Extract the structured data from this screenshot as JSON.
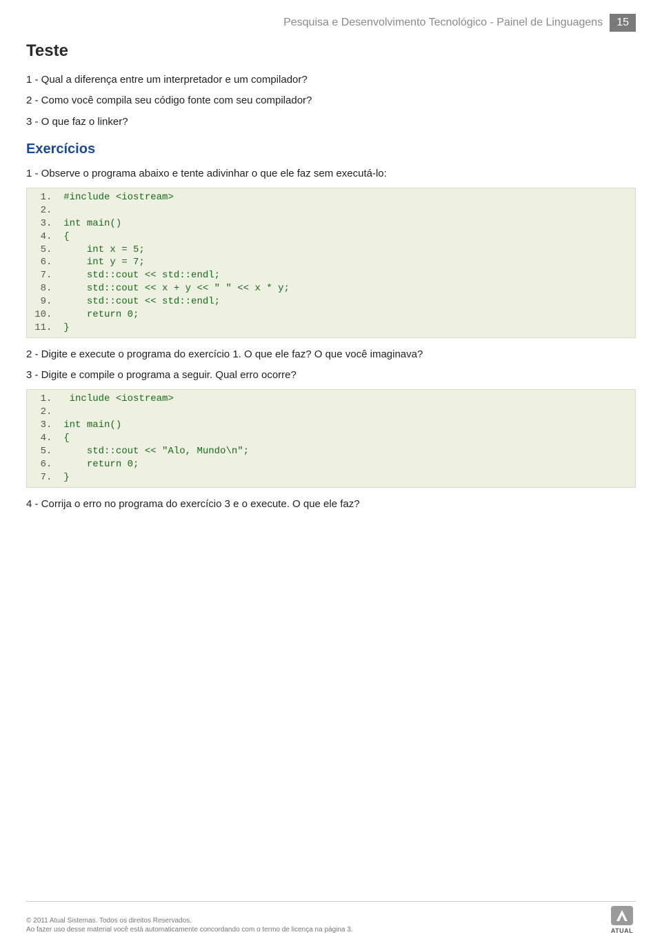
{
  "header": {
    "title": "Pesquisa e Desenvolvimento Tecnológico - Painel de Linguagens",
    "page_number": "15"
  },
  "section_test": {
    "heading": "Teste",
    "items": [
      "1 - Qual a diferença entre um interpretador e um compilador?",
      "2 - Como você compila seu código fonte com seu compilador?",
      "3 - O que faz o linker?"
    ]
  },
  "section_exercises": {
    "heading": "Exercícios",
    "intro1": "1 - Observe o programa abaixo e tente adivinhar o que ele faz sem executá-lo:",
    "code1": [
      {
        "n": "1",
        "text": "#include <iostream>",
        "cls": "kw"
      },
      {
        "n": "2",
        "text": "",
        "cls": ""
      },
      {
        "n": "3",
        "text": "int main()",
        "cls": "kw"
      },
      {
        "n": "4",
        "text": "{",
        "cls": "kw"
      },
      {
        "n": "5",
        "text": "    int x = 5;",
        "cls": "kw"
      },
      {
        "n": "6",
        "text": "    int y = 7;",
        "cls": "kw"
      },
      {
        "n": "7",
        "text": "    std::cout << std::endl;",
        "cls": "kw"
      },
      {
        "n": "8",
        "text": "    std::cout << x + y << \" \" << x * y;",
        "cls": "kw"
      },
      {
        "n": "9",
        "text": "    std::cout << std::endl;",
        "cls": "kw"
      },
      {
        "n": "10",
        "text": "    return 0;",
        "cls": "kw"
      },
      {
        "n": "11",
        "text": "}",
        "cls": "kw"
      }
    ],
    "intro2": "2 - Digite e execute o programa do exercício 1. O que ele faz? O que você imaginava?",
    "intro3": "3 - Digite e compile o programa a seguir. Qual erro ocorre?",
    "code2": [
      {
        "n": "1",
        "text": " include <iostream>",
        "cls": "kw"
      },
      {
        "n": "2",
        "text": "",
        "cls": ""
      },
      {
        "n": "3",
        "text": "int main()",
        "cls": "kw"
      },
      {
        "n": "4",
        "text": "{",
        "cls": "kw"
      },
      {
        "n": "5",
        "text": "    std::cout << \"Alo, Mundo\\n\";",
        "cls": "kw"
      },
      {
        "n": "6",
        "text": "    return 0;",
        "cls": "kw"
      },
      {
        "n": "7",
        "text": "}",
        "cls": "kw"
      }
    ],
    "intro4": "4 - Corrija o erro no programa do exercício 3 e o execute. O que ele faz?"
  },
  "footer": {
    "line1": "© 2011 Atual Sistemas. Todos os direitos Reservados.",
    "line2": "Ao fazer uso desse material você está automaticamente concordando com o termo de licença na página 3.",
    "logo_label": "ATUAL"
  }
}
